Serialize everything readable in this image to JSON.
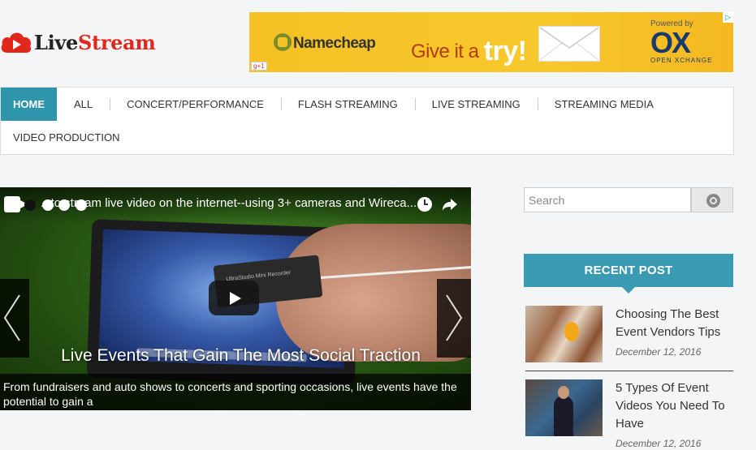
{
  "brand": {
    "name_part1": "Live",
    "name_part2": "Stream",
    "logo_color": "#e1271b"
  },
  "ad": {
    "advertiser": "Namecheap",
    "headline": "Give it a",
    "headline_emphasis": "try!",
    "powered_by": "Powered by",
    "partner": "OX",
    "partner_sub": "OPEN XCHANGE",
    "gplus": "g+1",
    "adchoices_icon": "adchoices-icon"
  },
  "nav": {
    "row1": [
      "HOME",
      "ALL",
      "CONCERT/PERFORMANCE",
      "FLASH STREAMING",
      "LIVE STREAMING",
      "STREAMING MEDIA"
    ],
    "row2": [
      "VIDEO PRODUCTION"
    ],
    "active": "HOME",
    "accent": "#2f95ad"
  },
  "slider": {
    "video_title": "...to stream live video on the internet--using 3+ cameras and Wireca...",
    "device_label": "UltraStudio Mini Recorder",
    "caption": "Live Events That Gain The Most Social Traction",
    "description": "From fundraisers and auto shows to concerts and sporting occasions, live events have the potential to gain a",
    "icons": [
      "video-camera-icon",
      "clock-icon",
      "share-icon",
      "play-icon",
      "chevron-left-icon",
      "chevron-right-icon"
    ]
  },
  "sidebar": {
    "search_placeholder": "Search",
    "recent_heading": "RECENT POST",
    "accent": "#3a9ab2",
    "posts": [
      {
        "title": "Choosing The Best Event Vendors Tips",
        "date": "December 12, 2016"
      },
      {
        "title": "5 Types Of Event Videos You Need To Have",
        "date": "December 12, 2016"
      }
    ]
  }
}
